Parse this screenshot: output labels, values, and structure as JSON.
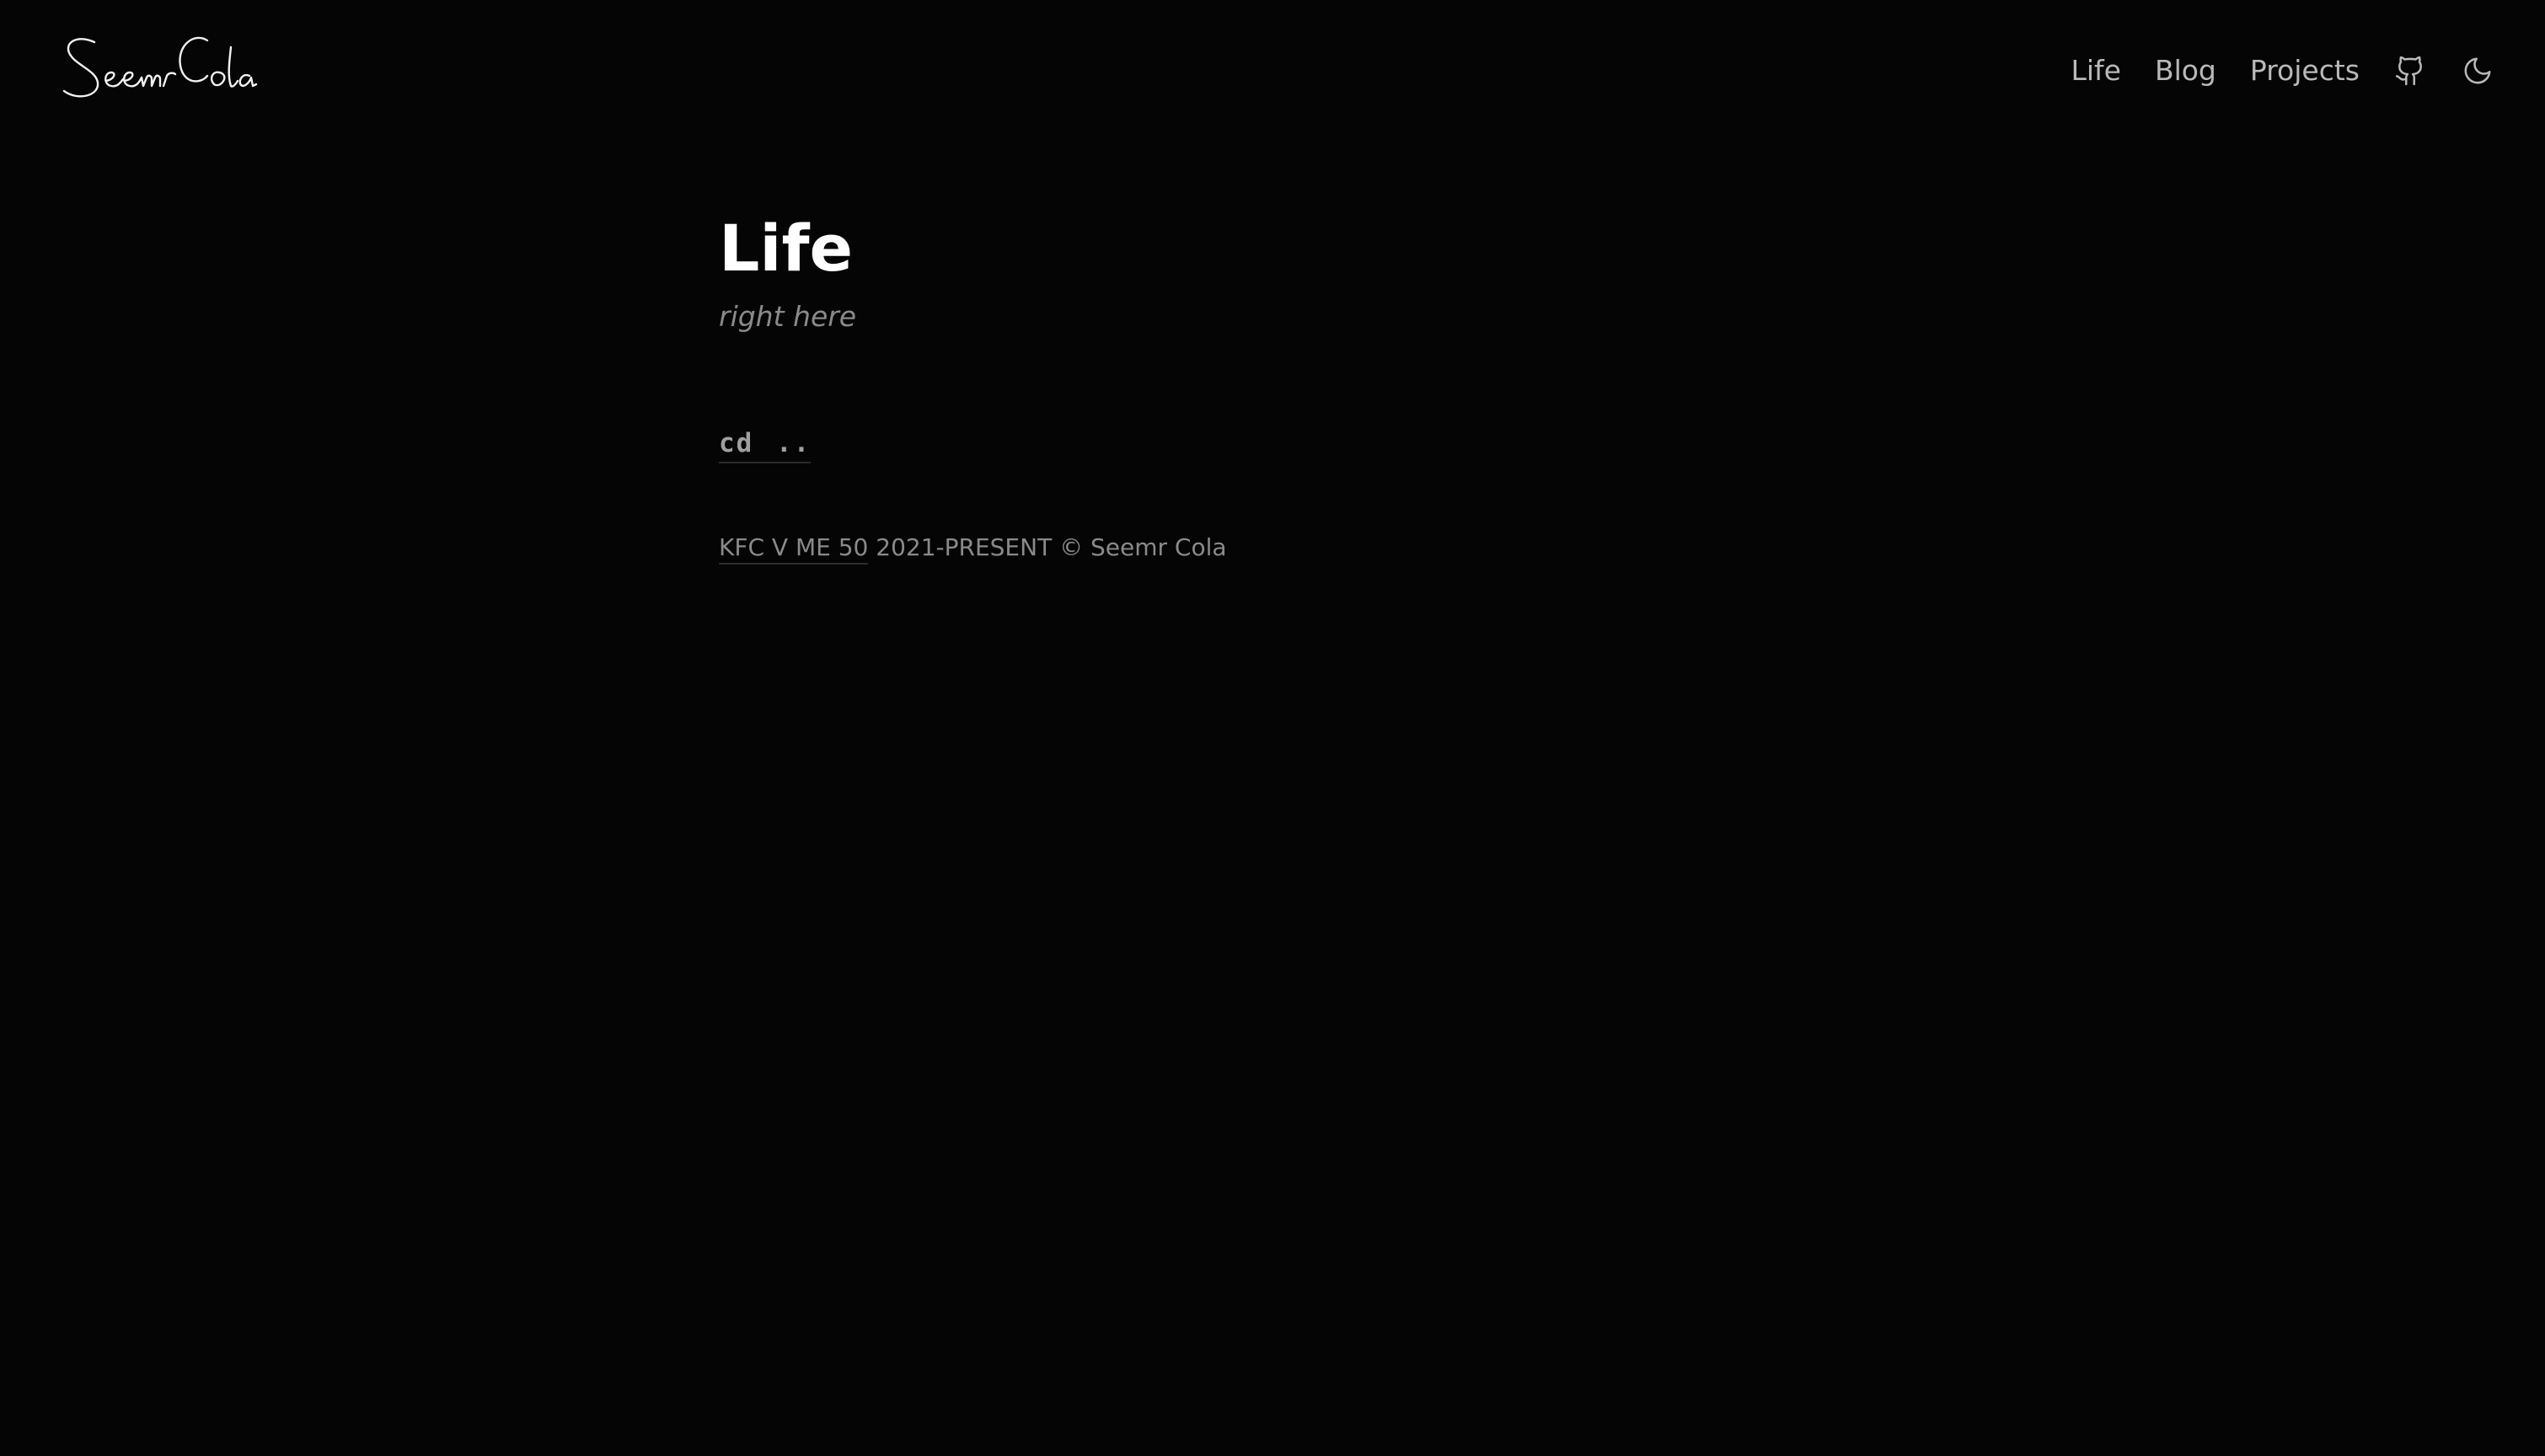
{
  "header": {
    "logo_text": "Seemr Cola",
    "nav": [
      {
        "label": "Life"
      },
      {
        "label": "Blog"
      },
      {
        "label": "Projects"
      }
    ],
    "icons": [
      "github-icon",
      "moon-icon"
    ]
  },
  "main": {
    "title": "Life",
    "subtitle": "right here",
    "back_link": "cd .."
  },
  "footer": {
    "license": "KFC V ME 50",
    "copyright": "2021-PRESENT © Seemr Cola"
  },
  "colors": {
    "background": "#050505",
    "title": "#ffffff",
    "nav_text": "#b9b9b9",
    "muted_text": "#8a8a8a"
  }
}
